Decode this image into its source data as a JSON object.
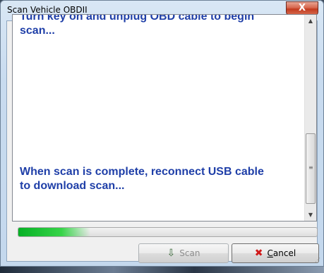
{
  "window": {
    "title": "Scan Vehicle OBDII",
    "close_glyph": "X"
  },
  "log": {
    "line_top_cut": "Turn key on and unplug OBD cable to begin",
    "line_top": "scan...",
    "line_bottom": "When scan is complete, reconnect USB cable\nto download scan..."
  },
  "progress": {
    "fraction": 0.24
  },
  "buttons": {
    "scan_label": "Scan",
    "cancel_label": "Cancel",
    "scan_icon": "scan-icon",
    "cancel_icon": "cancel-icon"
  },
  "colors": {
    "message_text": "#1f3fa8",
    "progress_fill": "#06b025",
    "close_button": "#c23b1f"
  }
}
